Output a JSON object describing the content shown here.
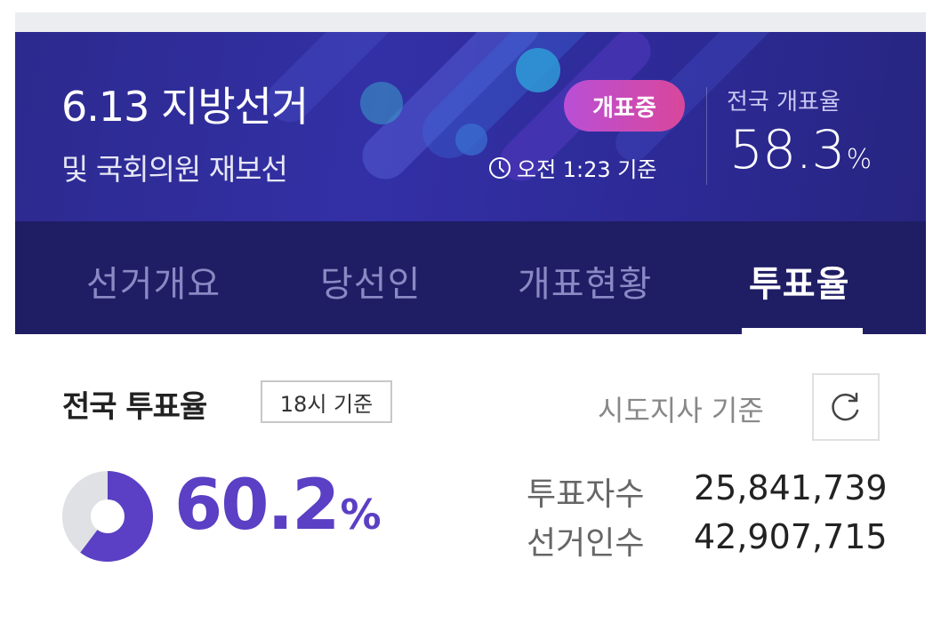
{
  "header": {
    "title": "6.13 지방선거",
    "subtitle": "및 국회의원 재보선",
    "status_badge": "개표중",
    "time": "오전 1:23 기준",
    "national_count_label": "전국 개표율",
    "national_count_value": "58.3",
    "national_count_unit": "%"
  },
  "tabs": [
    {
      "label": "선거개요",
      "active": false
    },
    {
      "label": "당선인",
      "active": false
    },
    {
      "label": "개표현황",
      "active": false
    },
    {
      "label": "투표율",
      "active": true
    }
  ],
  "turnout": {
    "title": "전국 투표율",
    "time_badge": "18시 기준",
    "basis": "시도지사 기준",
    "value": "60.2",
    "unit": "%",
    "fraction": 0.602,
    "voters_label": "투표자수",
    "voters_value": "25,841,739",
    "electorate_label": "선거인수",
    "electorate_value": "42,907,715"
  },
  "colors": {
    "banner": "#3330a6",
    "tabbar": "#1f1d64",
    "accent": "#5b3fc4",
    "badge_from": "#b94fd6",
    "badge_to": "#d9479b"
  },
  "icons": {
    "clock": "clock-icon",
    "refresh": "refresh-icon"
  }
}
